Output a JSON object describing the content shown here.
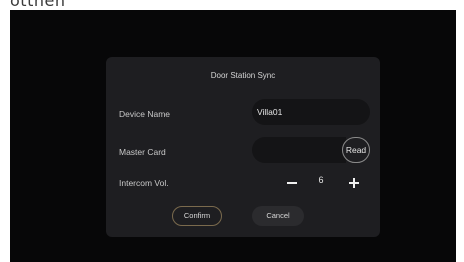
{
  "top_fragment": "ottnen",
  "dialog": {
    "title": "Door Station Sync",
    "device_name": {
      "label": "Device Name",
      "value": "Villa01"
    },
    "master_card": {
      "label": "Master Card",
      "value": "",
      "read_label": "Read"
    },
    "intercom_volume": {
      "label": "Intercom Vol.",
      "value": "6",
      "decrement_icon": "minus-icon",
      "increment_icon": "plus-icon"
    },
    "confirm_label": "Confirm",
    "cancel_label": "Cancel"
  },
  "colors": {
    "screen_background": "#070708",
    "dialog_background": "#1e1e21",
    "field_background": "#141416",
    "confirm_border": "#7a6a4d"
  }
}
